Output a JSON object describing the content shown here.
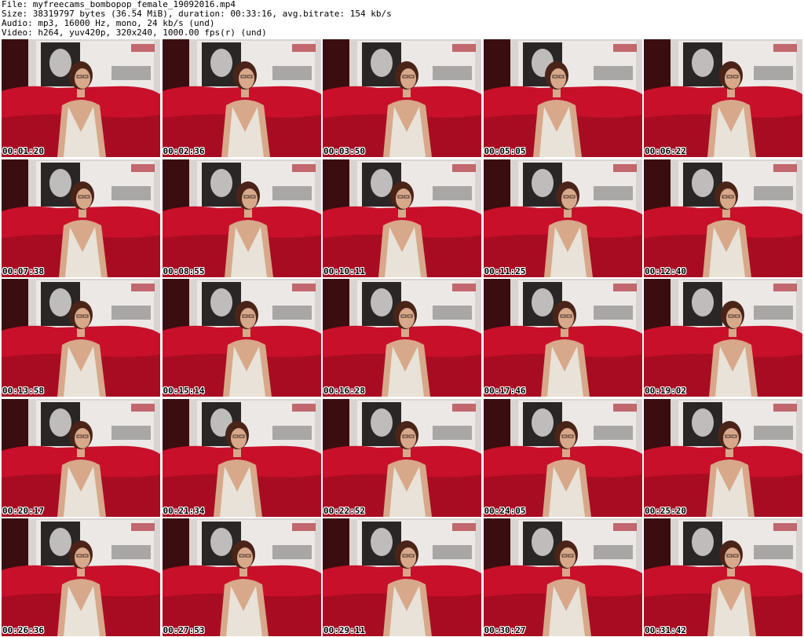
{
  "header": {
    "file": "File: myfreecams_bombopop_female_19092016.mp4",
    "size": "Size: 38319797 bytes (36.54 MiB), duration: 00:33:16, avg.bitrate: 154 kb/s",
    "audio": "Audio: mp3, 16000 Hz, mono, 24 kb/s (und)",
    "video": "Video: h264, yuv420p, 320x240, 1000.00 fps(r) (und)"
  },
  "thumbnails": [
    {
      "timestamp": "00:01:20"
    },
    {
      "timestamp": "00:02:36"
    },
    {
      "timestamp": "00:03:50"
    },
    {
      "timestamp": "00:05:05"
    },
    {
      "timestamp": "00:06:22"
    },
    {
      "timestamp": "00:07:38"
    },
    {
      "timestamp": "00:08:55"
    },
    {
      "timestamp": "00:10:11"
    },
    {
      "timestamp": "00:11:25"
    },
    {
      "timestamp": "00:12:40"
    },
    {
      "timestamp": "00:13:58"
    },
    {
      "timestamp": "00:15:14"
    },
    {
      "timestamp": "00:16:28"
    },
    {
      "timestamp": "00:17:46"
    },
    {
      "timestamp": "00:19:02"
    },
    {
      "timestamp": "00:20:17"
    },
    {
      "timestamp": "00:21:34"
    },
    {
      "timestamp": "00:22:52"
    },
    {
      "timestamp": "00:24:05"
    },
    {
      "timestamp": "00:25:20"
    },
    {
      "timestamp": "00:26:36"
    },
    {
      "timestamp": "00:27:53"
    },
    {
      "timestamp": "00:29:11"
    },
    {
      "timestamp": "00:30:27"
    },
    {
      "timestamp": "00:31:42"
    }
  ],
  "colors": {
    "sofa_red": "#c8102a",
    "curtain_dark": "#3a0d10",
    "wall": "#d9d4d2",
    "poster_dark": "#2a2626",
    "dress": "#e8e2d8",
    "skin": "#d7a88a",
    "hair": "#4a2418"
  }
}
